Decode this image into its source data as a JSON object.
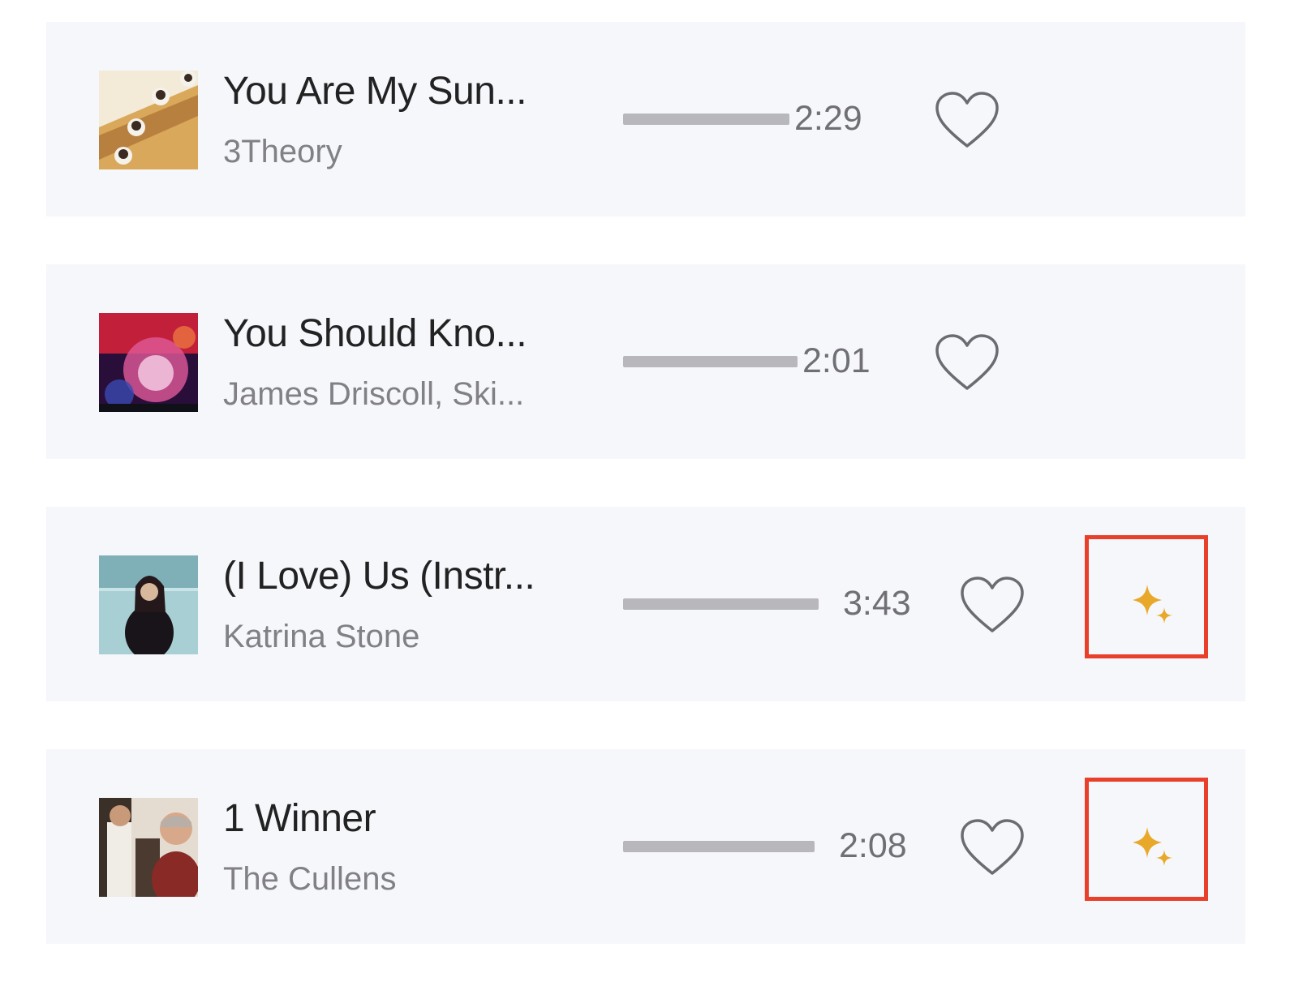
{
  "tracks": [
    {
      "title": "You Are My Sun...",
      "artist": "3Theory",
      "duration": "2:29",
      "favorited": false,
      "has_sparkle": false
    },
    {
      "title": "You Should Kno...",
      "artist": "James Driscoll, Ski...",
      "duration": "2:01",
      "favorited": false,
      "has_sparkle": false
    },
    {
      "title": "(I Love) Us (Instr...",
      "artist": "Katrina Stone",
      "duration": "3:43",
      "favorited": false,
      "has_sparkle": true
    },
    {
      "title": "1 Winner",
      "artist": "The Cullens",
      "duration": "2:08",
      "favorited": false,
      "has_sparkle": true
    }
  ],
  "icons": {
    "favorite": "heart-outline-icon",
    "sparkle": "sparkle-icon"
  },
  "colors": {
    "row_background": "#f6f7fb",
    "highlight_border": "#e8402a",
    "sparkle": "#e8a92a",
    "waveform": "#b8b8bc"
  }
}
